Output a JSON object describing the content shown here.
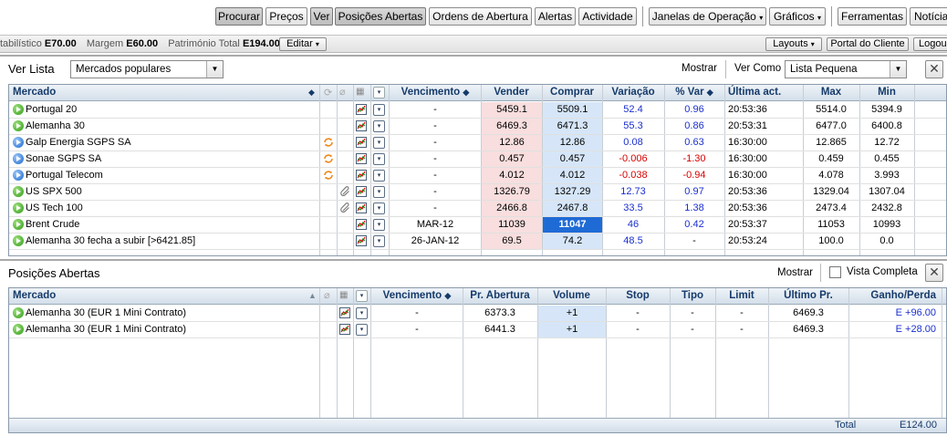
{
  "toolbar": {
    "buttons": [
      "Procurar",
      "Preços",
      "Ver",
      "Posições Abertas",
      "Ordens de Abertura",
      "Alertas",
      "Actividade",
      "Janelas de Operação",
      "Gráficos",
      "Ferramentas",
      "Notícias"
    ]
  },
  "account": {
    "items": [
      {
        "label": "tabilístico",
        "value": "E70.00"
      },
      {
        "label": "Margem",
        "value": "E60.00"
      },
      {
        "label": "Património Total",
        "value": "E194.00"
      }
    ],
    "edit_label": "Editar",
    "right_buttons": [
      "Layouts",
      "Portal do Cliente",
      "Logou"
    ]
  },
  "watchlist": {
    "title": "Ver Lista",
    "select_value": "Mercados populares",
    "show_label": "Mostrar",
    "view_as_label": "Ver Como",
    "view_as_value": "Lista Pequena",
    "columns": {
      "market": "Mercado",
      "expiry": "Vencimento",
      "sell": "Vender",
      "buy": "Comprar",
      "change": "Variação",
      "pct": "% Var",
      "last": "Última act.",
      "max": "Max",
      "min": "Min"
    },
    "rows": [
      {
        "icon": "g",
        "name": "Portugal 20",
        "link": false,
        "attach": false,
        "expiry": "-",
        "sell": "5459.1",
        "buy": "5509.1",
        "change": "52.4",
        "pct": "0.96",
        "last": "20:53:36",
        "max": "5514.0",
        "min": "5394.9",
        "neg": false,
        "hl": false
      },
      {
        "icon": "g",
        "name": "Alemanha 30",
        "link": false,
        "attach": false,
        "expiry": "-",
        "sell": "6469.3",
        "buy": "6471.3",
        "change": "55.3",
        "pct": "0.86",
        "last": "20:53:31",
        "max": "6477.0",
        "min": "6400.8",
        "neg": false,
        "hl": false
      },
      {
        "icon": "b",
        "name": "Galp Energia SGPS SA",
        "link": true,
        "attach": false,
        "expiry": "-",
        "sell": "12.86",
        "buy": "12.86",
        "change": "0.08",
        "pct": "0.63",
        "last": "16:30:00",
        "max": "12.865",
        "min": "12.72",
        "neg": false,
        "hl": false
      },
      {
        "icon": "b",
        "name": "Sonae SGPS SA",
        "link": true,
        "attach": false,
        "expiry": "-",
        "sell": "0.457",
        "buy": "0.457",
        "change": "-0.006",
        "pct": "-1.30",
        "last": "16:30:00",
        "max": "0.459",
        "min": "0.455",
        "neg": true,
        "hl": false
      },
      {
        "icon": "b",
        "name": "Portugal Telecom",
        "link": true,
        "attach": false,
        "expiry": "-",
        "sell": "4.012",
        "buy": "4.012",
        "change": "-0.038",
        "pct": "-0.94",
        "last": "16:30:00",
        "max": "4.078",
        "min": "3.993",
        "neg": true,
        "hl": false
      },
      {
        "icon": "g",
        "name": "US SPX 500",
        "link": false,
        "attach": true,
        "expiry": "-",
        "sell": "1326.79",
        "buy": "1327.29",
        "change": "12.73",
        "pct": "0.97",
        "last": "20:53:36",
        "max": "1329.04",
        "min": "1307.04",
        "neg": false,
        "hl": false
      },
      {
        "icon": "g",
        "name": "US Tech 100",
        "link": false,
        "attach": true,
        "expiry": "-",
        "sell": "2466.8",
        "buy": "2467.8",
        "change": "33.5",
        "pct": "1.38",
        "last": "20:53:36",
        "max": "2473.4",
        "min": "2432.8",
        "neg": false,
        "hl": false
      },
      {
        "icon": "g",
        "name": "Brent Crude",
        "link": false,
        "attach": false,
        "expiry": "MAR-12",
        "sell": "11039",
        "buy": "11047",
        "change": "46",
        "pct": "0.42",
        "last": "20:53:37",
        "max": "11053",
        "min": "10993",
        "neg": false,
        "hl": true
      },
      {
        "icon": "g",
        "name": "Alemanha 30 fecha a subir [>6421.85]",
        "link": false,
        "attach": false,
        "expiry": "26-JAN-12",
        "sell": "69.5",
        "buy": "74.2",
        "change": "48.5",
        "pct": "-",
        "last": "20:53:24",
        "max": "100.0",
        "min": "0.0",
        "neg": false,
        "hl": false
      }
    ]
  },
  "positions": {
    "title": "Posições Abertas",
    "show_label": "Mostrar",
    "full_view_label": "Vista Completa",
    "columns": {
      "market": "Mercado",
      "expiry": "Vencimento",
      "open_price": "Pr. Abertura",
      "volume": "Volume",
      "stop": "Stop",
      "type": "Tipo",
      "limit": "Limit",
      "last_price": "Último Pr.",
      "pnl": "Ganho/Perda"
    },
    "rows": [
      {
        "name": "Alemanha 30 (EUR 1 Mini Contrato)",
        "expiry": "-",
        "open_price": "6373.3",
        "volume": "+1",
        "stop": "-",
        "type": "-",
        "limit": "-",
        "last_price": "6469.3",
        "pnl": "E +96.00"
      },
      {
        "name": "Alemanha 30 (EUR 1 Mini Contrato)",
        "expiry": "-",
        "open_price": "6441.3",
        "volume": "+1",
        "stop": "-",
        "type": "-",
        "limit": "-",
        "last_price": "6469.3",
        "pnl": "E +28.00"
      }
    ],
    "total_label": "Total",
    "total_value": "E124.00"
  }
}
